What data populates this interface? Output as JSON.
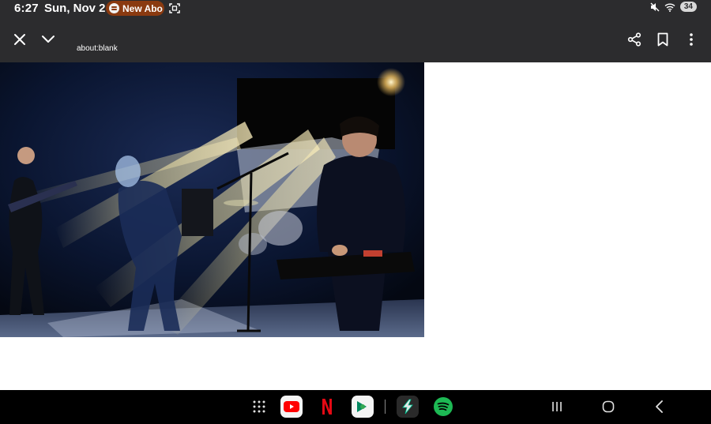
{
  "status_bar": {
    "time": "6:27",
    "date": "Sun, Nov 2",
    "media_pill_text": "New Abo",
    "battery": "34"
  },
  "toolbar": {
    "url": "about:blank"
  },
  "icons": {
    "close": "close-icon",
    "collapse": "chevron-down-icon",
    "share": "share-icon",
    "bookmark": "bookmark-icon",
    "more": "more-vert-icon"
  },
  "dock": {
    "apps": [
      "app-drawer",
      "youtube",
      "netflix",
      "play-games",
      "power-app",
      "spotify"
    ]
  },
  "colors": {
    "toolbar_bg": "#2c2c2e",
    "pill_bg": "#8a3a10",
    "youtube_red": "#ff0000",
    "netflix_red": "#e50914",
    "spotify_green": "#1db954"
  }
}
